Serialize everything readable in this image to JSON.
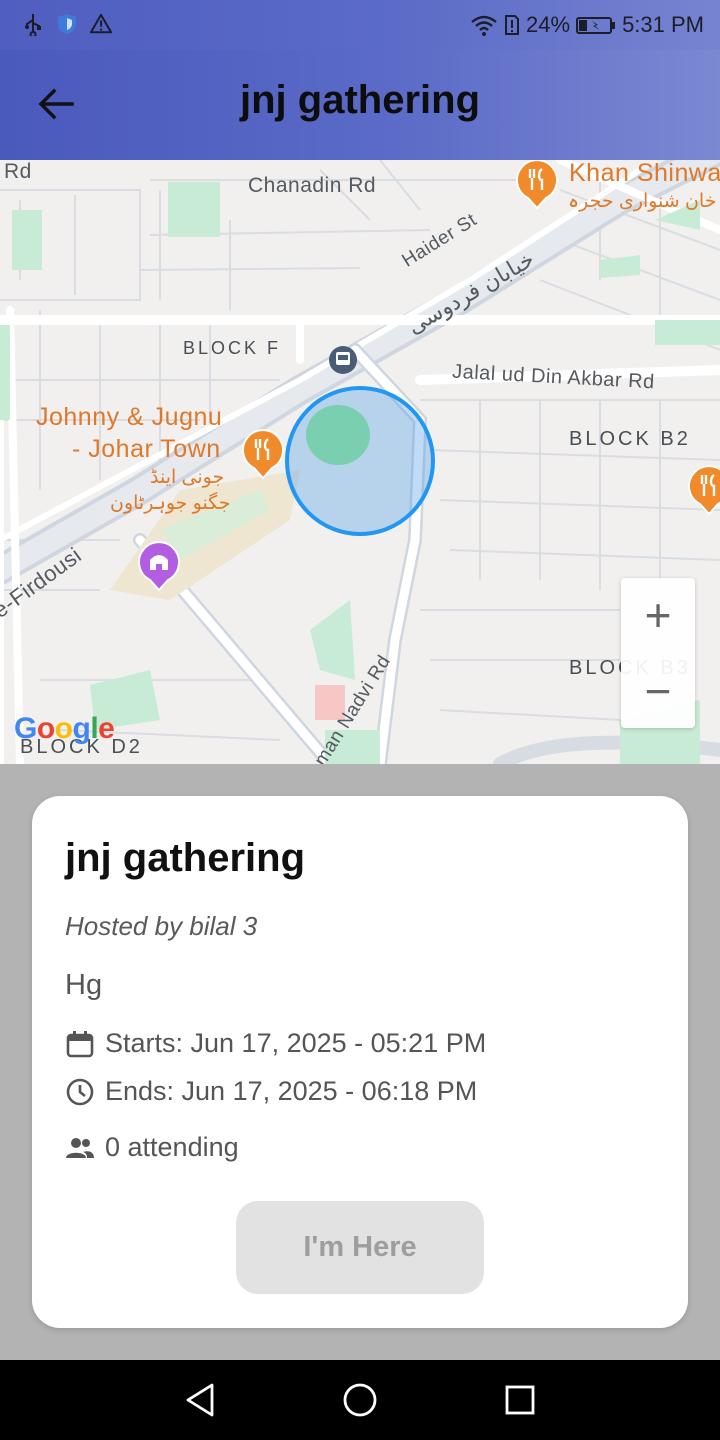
{
  "status_bar": {
    "battery": "24%",
    "time": "5:31 PM"
  },
  "app_bar": {
    "title": "jnj gathering"
  },
  "map": {
    "labels": {
      "rd_left": "Rd",
      "chanadin_rd": "Chanadin Rd",
      "haider_st": "Haider St",
      "khayaban_urdu": "خیابان فردوسی",
      "block_f": "BLOCK F",
      "jalal_rd": "Jalal ud Din Akbar Rd",
      "block_b2": "BLOCK B2",
      "johnny_line1": "Johnny & Jugnu",
      "johnny_line2": "- Johar Town",
      "johnny_urdu1": "جونی اینڈ",
      "johnny_urdu2": "جگنو جوہرٹاون",
      "firdousi": "e-Firdousi",
      "khan_shinwari": "Khan Shinwa",
      "khan_urdu": "خان شنواری حجرہ",
      "nadvi_rd": "man Nadvi Rd",
      "block_b3": "BLOCK B3",
      "block_d2": "BLOCK D2"
    },
    "zoom_in": "+",
    "zoom_out": "−",
    "google": [
      "G",
      "o",
      "o",
      "g",
      "l",
      "e"
    ],
    "google_colors": [
      "#4285F4",
      "#EA4335",
      "#FBBC05",
      "#4285F4",
      "#34A853",
      "#EA4335"
    ]
  },
  "event": {
    "title": "jnj gathering",
    "host": "Hosted by bilal 3",
    "description": "Hg",
    "starts": "Starts: Jun 17, 2025 - 05:21 PM",
    "ends": "Ends: Jun 17, 2025 - 06:18 PM",
    "attending": "0 attending",
    "checkin_label": "I'm Here"
  },
  "colors": {
    "accent": "#5b6bc7",
    "geofence": "#2196f3",
    "poi_orange": "#f08a2a",
    "poi_purple": "#b35ee0"
  }
}
